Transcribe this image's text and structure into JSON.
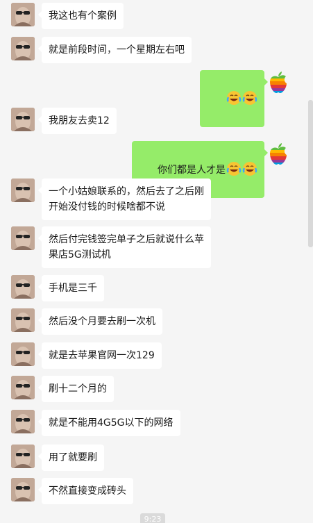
{
  "window": {
    "title": ""
  },
  "messages": [
    {
      "side": "other",
      "text": "我这也有个案例",
      "avatar": "friend-avatar"
    },
    {
      "side": "other",
      "text": "就是前段时间，一个星期左右吧",
      "avatar": "friend-avatar"
    },
    {
      "side": "me",
      "text": "",
      "emojis": [
        "laugh-cry-emoji",
        "laugh-cry-emoji"
      ],
      "avatar": "apple-logo-avatar"
    },
    {
      "side": "other",
      "text": "我朋友去卖12",
      "avatar": "friend-avatar"
    },
    {
      "side": "me",
      "text": "你们都是人才是",
      "emojis": [
        "laugh-cry-emoji",
        "laugh-cry-emoji"
      ],
      "avatar": "apple-logo-avatar"
    },
    {
      "side": "other",
      "text": "一个小姑娘联系的，然后去了之后刚开始没付钱的时候啥都不说",
      "avatar": "friend-avatar"
    },
    {
      "side": "other",
      "text": "然后付完钱签完单子之后就说什么苹果店5G测试机",
      "avatar": "friend-avatar"
    },
    {
      "side": "other",
      "text": "手机是三千",
      "avatar": "friend-avatar"
    },
    {
      "side": "other",
      "text": "然后没个月要去刷一次机",
      "avatar": "friend-avatar"
    },
    {
      "side": "other",
      "text": "就是去苹果官网一次129",
      "avatar": "friend-avatar"
    },
    {
      "side": "other",
      "text": "刷十二个月的",
      "avatar": "friend-avatar"
    },
    {
      "side": "other",
      "text": "就是不能用4G5G以下的网络",
      "avatar": "friend-avatar"
    },
    {
      "side": "other",
      "text": "用了就要刷",
      "avatar": "friend-avatar"
    },
    {
      "side": "other",
      "text": "不然直接变成砖头",
      "avatar": "friend-avatar"
    }
  ],
  "timestamp": "9:23",
  "colors": {
    "background": "#f5f5f5",
    "bubble_other": "#ffffff",
    "bubble_me": "#95ec69",
    "text": "#191919"
  }
}
